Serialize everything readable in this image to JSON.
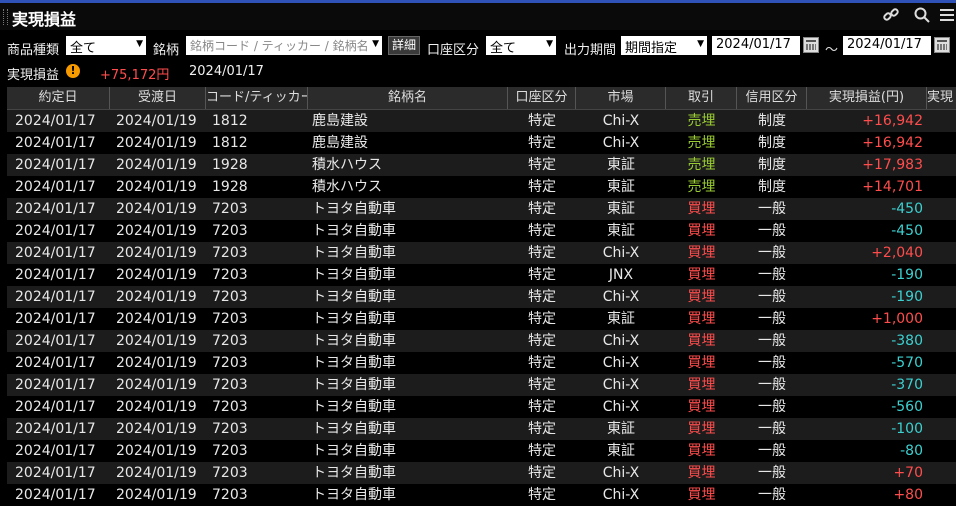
{
  "window": {
    "title": "実現損益"
  },
  "toolbar_icons": [
    "link-icon",
    "search-icon",
    "menu-icon"
  ],
  "filters": {
    "product_type_label": "商品種類",
    "product_type_value": "全て",
    "symbol_label": "銘柄",
    "symbol_placeholder": "銘柄コード / ティッカー / 銘柄名",
    "detail_button": "詳細",
    "account_label": "口座区分",
    "account_value": "全て",
    "period_label": "出力期間",
    "period_value": "期間指定",
    "date_from": "2024/01/17",
    "tilde": "～",
    "date_to": "2024/01/17"
  },
  "summary": {
    "label": "実現損益",
    "warning_icon": "!",
    "total": "+75,172円",
    "date": "2024/01/17"
  },
  "columns": [
    "約定日",
    "受渡日",
    "コード/ティッカー",
    "銘柄名",
    "口座区分",
    "市場",
    "取引",
    "信用区分",
    "実現損益(円)",
    "実現"
  ],
  "colors": {
    "positive": "#ff4d4d",
    "negative": "#3cd0d0",
    "sell": "#9acd32",
    "buy": "#ff4d4d",
    "accent": "#2f52b8"
  },
  "rows": [
    {
      "trade_date": "2024/01/17",
      "settle_date": "2024/01/19",
      "code": "1812",
      "name": "鹿島建設",
      "account": "特定",
      "market": "Chi-X",
      "side": "売埋",
      "side_type": "sell",
      "margin": "制度",
      "pnl": "+16,942",
      "pnl_sign": "pos"
    },
    {
      "trade_date": "2024/01/17",
      "settle_date": "2024/01/19",
      "code": "1812",
      "name": "鹿島建設",
      "account": "特定",
      "market": "Chi-X",
      "side": "売埋",
      "side_type": "sell",
      "margin": "制度",
      "pnl": "+16,942",
      "pnl_sign": "pos"
    },
    {
      "trade_date": "2024/01/17",
      "settle_date": "2024/01/19",
      "code": "1928",
      "name": "積水ハウス",
      "account": "特定",
      "market": "東証",
      "side": "売埋",
      "side_type": "sell",
      "margin": "制度",
      "pnl": "+17,983",
      "pnl_sign": "pos"
    },
    {
      "trade_date": "2024/01/17",
      "settle_date": "2024/01/19",
      "code": "1928",
      "name": "積水ハウス",
      "account": "特定",
      "market": "東証",
      "side": "売埋",
      "side_type": "sell",
      "margin": "制度",
      "pnl": "+14,701",
      "pnl_sign": "pos"
    },
    {
      "trade_date": "2024/01/17",
      "settle_date": "2024/01/19",
      "code": "7203",
      "name": "トヨタ自動車",
      "account": "特定",
      "market": "東証",
      "side": "買埋",
      "side_type": "buy",
      "margin": "一般",
      "pnl": "-450",
      "pnl_sign": "neg"
    },
    {
      "trade_date": "2024/01/17",
      "settle_date": "2024/01/19",
      "code": "7203",
      "name": "トヨタ自動車",
      "account": "特定",
      "market": "東証",
      "side": "買埋",
      "side_type": "buy",
      "margin": "一般",
      "pnl": "-450",
      "pnl_sign": "neg"
    },
    {
      "trade_date": "2024/01/17",
      "settle_date": "2024/01/19",
      "code": "7203",
      "name": "トヨタ自動車",
      "account": "特定",
      "market": "Chi-X",
      "side": "買埋",
      "side_type": "buy",
      "margin": "一般",
      "pnl": "+2,040",
      "pnl_sign": "pos"
    },
    {
      "trade_date": "2024/01/17",
      "settle_date": "2024/01/19",
      "code": "7203",
      "name": "トヨタ自動車",
      "account": "特定",
      "market": "JNX",
      "side": "買埋",
      "side_type": "buy",
      "margin": "一般",
      "pnl": "-190",
      "pnl_sign": "neg"
    },
    {
      "trade_date": "2024/01/17",
      "settle_date": "2024/01/19",
      "code": "7203",
      "name": "トヨタ自動車",
      "account": "特定",
      "market": "Chi-X",
      "side": "買埋",
      "side_type": "buy",
      "margin": "一般",
      "pnl": "-190",
      "pnl_sign": "neg"
    },
    {
      "trade_date": "2024/01/17",
      "settle_date": "2024/01/19",
      "code": "7203",
      "name": "トヨタ自動車",
      "account": "特定",
      "market": "東証",
      "side": "買埋",
      "side_type": "buy",
      "margin": "一般",
      "pnl": "+1,000",
      "pnl_sign": "pos"
    },
    {
      "trade_date": "2024/01/17",
      "settle_date": "2024/01/19",
      "code": "7203",
      "name": "トヨタ自動車",
      "account": "特定",
      "market": "Chi-X",
      "side": "買埋",
      "side_type": "buy",
      "margin": "一般",
      "pnl": "-380",
      "pnl_sign": "neg"
    },
    {
      "trade_date": "2024/01/17",
      "settle_date": "2024/01/19",
      "code": "7203",
      "name": "トヨタ自動車",
      "account": "特定",
      "market": "Chi-X",
      "side": "買埋",
      "side_type": "buy",
      "margin": "一般",
      "pnl": "-570",
      "pnl_sign": "neg"
    },
    {
      "trade_date": "2024/01/17",
      "settle_date": "2024/01/19",
      "code": "7203",
      "name": "トヨタ自動車",
      "account": "特定",
      "market": "Chi-X",
      "side": "買埋",
      "side_type": "buy",
      "margin": "一般",
      "pnl": "-370",
      "pnl_sign": "neg"
    },
    {
      "trade_date": "2024/01/17",
      "settle_date": "2024/01/19",
      "code": "7203",
      "name": "トヨタ自動車",
      "account": "特定",
      "market": "Chi-X",
      "side": "買埋",
      "side_type": "buy",
      "margin": "一般",
      "pnl": "-560",
      "pnl_sign": "neg"
    },
    {
      "trade_date": "2024/01/17",
      "settle_date": "2024/01/19",
      "code": "7203",
      "name": "トヨタ自動車",
      "account": "特定",
      "market": "東証",
      "side": "買埋",
      "side_type": "buy",
      "margin": "一般",
      "pnl": "-100",
      "pnl_sign": "neg"
    },
    {
      "trade_date": "2024/01/17",
      "settle_date": "2024/01/19",
      "code": "7203",
      "name": "トヨタ自動車",
      "account": "特定",
      "market": "東証",
      "side": "買埋",
      "side_type": "buy",
      "margin": "一般",
      "pnl": "-80",
      "pnl_sign": "neg"
    },
    {
      "trade_date": "2024/01/17",
      "settle_date": "2024/01/19",
      "code": "7203",
      "name": "トヨタ自動車",
      "account": "特定",
      "market": "Chi-X",
      "side": "買埋",
      "side_type": "buy",
      "margin": "一般",
      "pnl": "+70",
      "pnl_sign": "pos"
    },
    {
      "trade_date": "2024/01/17",
      "settle_date": "2024/01/19",
      "code": "7203",
      "name": "トヨタ自動車",
      "account": "特定",
      "market": "Chi-X",
      "side": "買埋",
      "side_type": "buy",
      "margin": "一般",
      "pnl": "+80",
      "pnl_sign": "pos"
    }
  ]
}
